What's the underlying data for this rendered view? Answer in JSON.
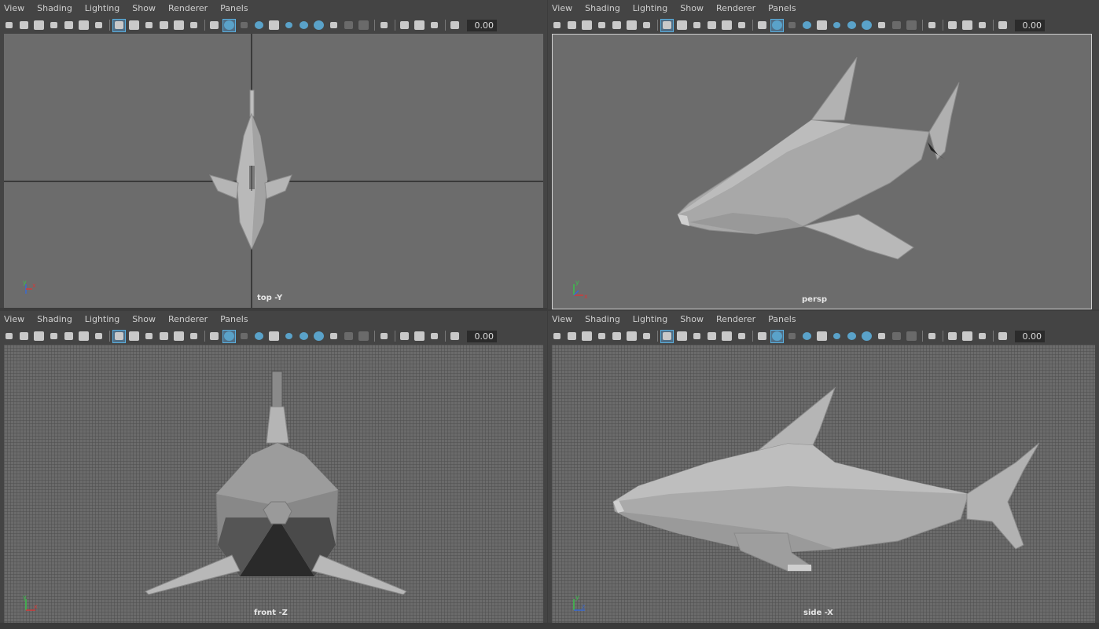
{
  "menus": [
    "View",
    "Shading",
    "Lighting",
    "Show",
    "Renderer",
    "Panels"
  ],
  "toolbar": {
    "icons": [
      "camera-icon",
      "camera-attr-icon",
      "bookmark-camera-icon",
      "bookmark-icon",
      "grease-pencil-icon",
      "pan-zoom-icon",
      "paint-icon",
      "grid-icon",
      "film-gate-icon",
      "resolution-gate-icon",
      "gate-mask-icon",
      "field-chart-icon",
      "safe-title-icon",
      "wireframe-icon",
      "smooth-shade-icon",
      "default-material-icon",
      "wireframe-on-shaded-icon",
      "textured-icon",
      "use-all-lights-icon",
      "shadows-icon",
      "screen-space-ao-icon",
      "motion-blur-icon",
      "anti-alias-icon",
      "depth-of-field-icon",
      "isolate-select-icon",
      "xray-icon",
      "xray-joints-icon",
      "backface-icon",
      "exposure-icon"
    ],
    "exposure_value": "0.00"
  },
  "viewports": {
    "top": {
      "label": "top -Y"
    },
    "persp": {
      "label": "persp"
    },
    "front": {
      "label": "front -Z"
    },
    "side": {
      "label": "side -X"
    }
  },
  "colors": {
    "axis_x": "#d23a3a",
    "axis_y": "#3ac24a",
    "axis_z": "#3a6ad2",
    "active_tool": "#5aa2c9"
  }
}
